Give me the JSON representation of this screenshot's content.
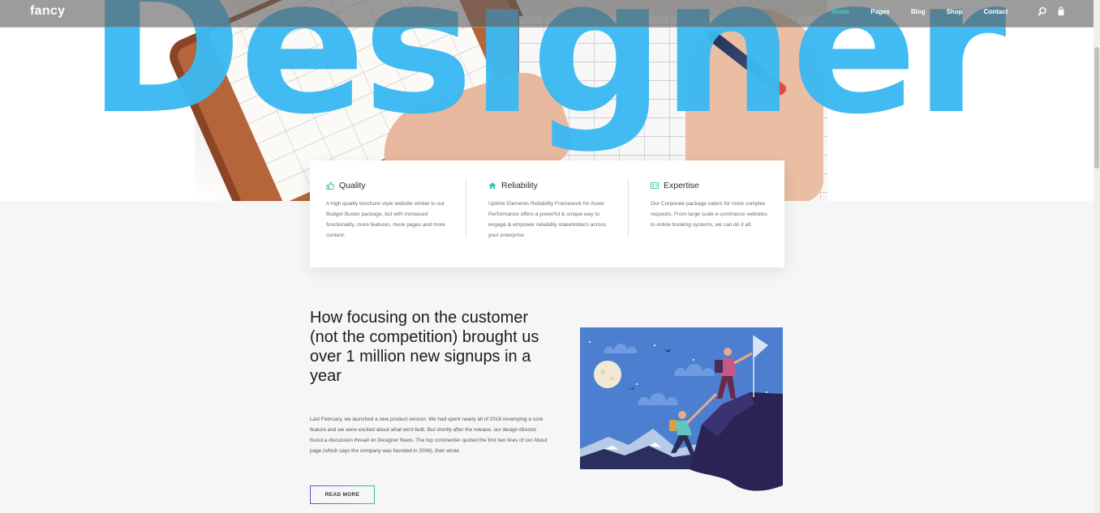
{
  "navbar": {
    "logo": "fancy",
    "links": [
      {
        "label": "Home",
        "active": true
      },
      {
        "label": "Pages"
      },
      {
        "label": "Blog"
      },
      {
        "label": "Shop"
      },
      {
        "label": "Contact"
      }
    ],
    "icons": [
      "search-icon",
      "bag-icon"
    ],
    "active_color": "#44d4b0"
  },
  "hero": {
    "word": "Designer",
    "word_color": "#3bb9f2"
  },
  "features": [
    {
      "icon": "thumbs-up-icon",
      "title": "Quality",
      "text": "A high quality brochure style website similar to our Budget Buster package, but with increased functionality, more features, more pages and more content."
    },
    {
      "icon": "home-icon",
      "title": "Reliability",
      "text": "Uptime Elements Reliability Framework for Asset Performance offers a powerful & unique way to engage & empower reliability stakeholders across your enterprise"
    },
    {
      "icon": "id-card-icon",
      "title": "Expertise",
      "text": "Our Corporate package caters for more complex requests. From large scale e-commerce websites to online booking systems, we can do it all."
    }
  ],
  "article": {
    "title": "How focusing on the customer (not the competition) brought us over 1 million new signups in a year",
    "body": "Last February, we launched a new product version. We had spent nearly all of 2016 revamping a core feature and we were excited about what we'd built. But shortly after the release, our design director found a discussion thread on Designer News. The top commenter quoted the first two lines of our About page (which says the company was founded in 2006), then wrote",
    "button_label": "READ MORE"
  },
  "colors": {
    "accent_teal": "#2fc7b0",
    "accent_purple": "#7b3fe0",
    "illustration_sky": "#4d7fd0"
  }
}
